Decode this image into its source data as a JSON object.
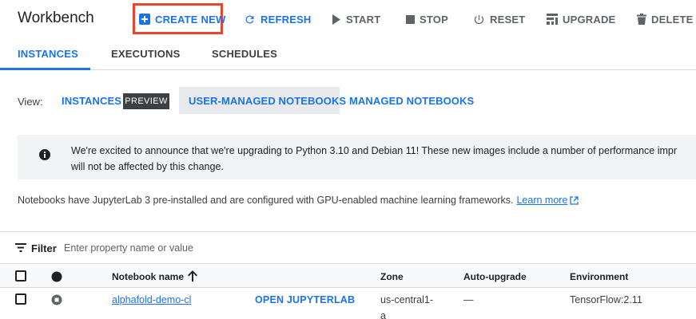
{
  "toolbar": {
    "title": "Workbench",
    "create_new": "CREATE NEW",
    "refresh": "REFRESH",
    "start": "START",
    "stop": "STOP",
    "reset": "RESET",
    "upgrade": "UPGRADE",
    "delete": "DELETE"
  },
  "tabs": [
    {
      "label": "INSTANCES",
      "active": true
    },
    {
      "label": "EXECUTIONS",
      "active": false
    },
    {
      "label": "SCHEDULES",
      "active": false
    }
  ],
  "view": {
    "label": "View:",
    "options": [
      "INSTANCES",
      "USER-MANAGED NOTEBOOKS",
      "MANAGED NOTEBOOKS"
    ],
    "badge": "PREVIEW",
    "selected": "USER-MANAGED NOTEBOOKS"
  },
  "banner": {
    "icon": "info-icon",
    "line1": "We're excited to announce that we're upgrading to Python 3.10 and Debian 11! These new images include a number of performance impr",
    "line2": "will not be affected by this change."
  },
  "notice": {
    "text": "Notebooks have JupyterLab 3 pre-installed and are configured with GPU-enabled machine learning frameworks.",
    "link": "Learn more"
  },
  "filter": {
    "label": "Filter",
    "placeholder": "Enter property name or value"
  },
  "table": {
    "columns": [
      "Notebook name",
      "Zone",
      "Auto-upgrade",
      "Environment"
    ],
    "rows": [
      {
        "name": "alphafold-demo-cl",
        "action": "OPEN JUPYTERLAB",
        "zone_line1": "us-central1-",
        "zone_line2": "a",
        "auto_upgrade": "—",
        "environment": "TensorFlow:2.11"
      }
    ]
  },
  "colors": {
    "accent": "#1a73e8",
    "highlight_box": "#e8452c"
  }
}
